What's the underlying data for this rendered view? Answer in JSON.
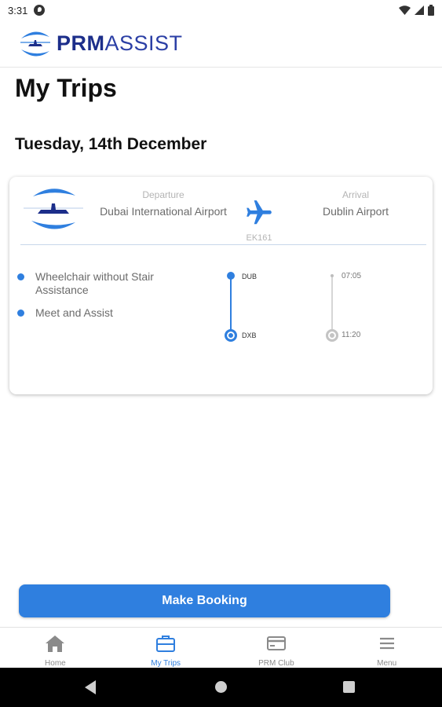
{
  "status_bar": {
    "time": "3:31",
    "icons": [
      "notification-icon",
      "wifi-icon",
      "signal-icon",
      "battery-icon"
    ]
  },
  "header": {
    "logo_bold": "PRM",
    "logo_light": "ASSIST",
    "brand_color": "#1c2e8a"
  },
  "page": {
    "title": "My Trips",
    "date_heading": "Tuesday, 14th December"
  },
  "trip": {
    "departure_label": "Departure",
    "departure_airport": "Dubai International Airport",
    "arrival_label": "Arrival",
    "arrival_airport": "Dublin Airport",
    "flight_number": "EK161",
    "services": [
      "Wheelchair without Stair Assistance",
      "Meet and Assist"
    ],
    "timeline": {
      "top_code": "DUB",
      "bottom_code": "DXB",
      "top_time": "07:05",
      "bottom_time": "11:20"
    }
  },
  "actions": {
    "make_booking_label": "Make Booking",
    "accent_color": "#2f7fdf"
  },
  "bottom_nav": {
    "items": [
      {
        "label": "Home",
        "icon": "home-icon",
        "active": false
      },
      {
        "label": "My Trips",
        "icon": "briefcase-icon",
        "active": true
      },
      {
        "label": "PRM Club",
        "icon": "card-icon",
        "active": false
      },
      {
        "label": "Menu",
        "icon": "menu-icon",
        "active": false
      }
    ]
  },
  "system_nav": {
    "buttons": [
      "back-icon",
      "home-circle-icon",
      "recents-icon"
    ]
  }
}
